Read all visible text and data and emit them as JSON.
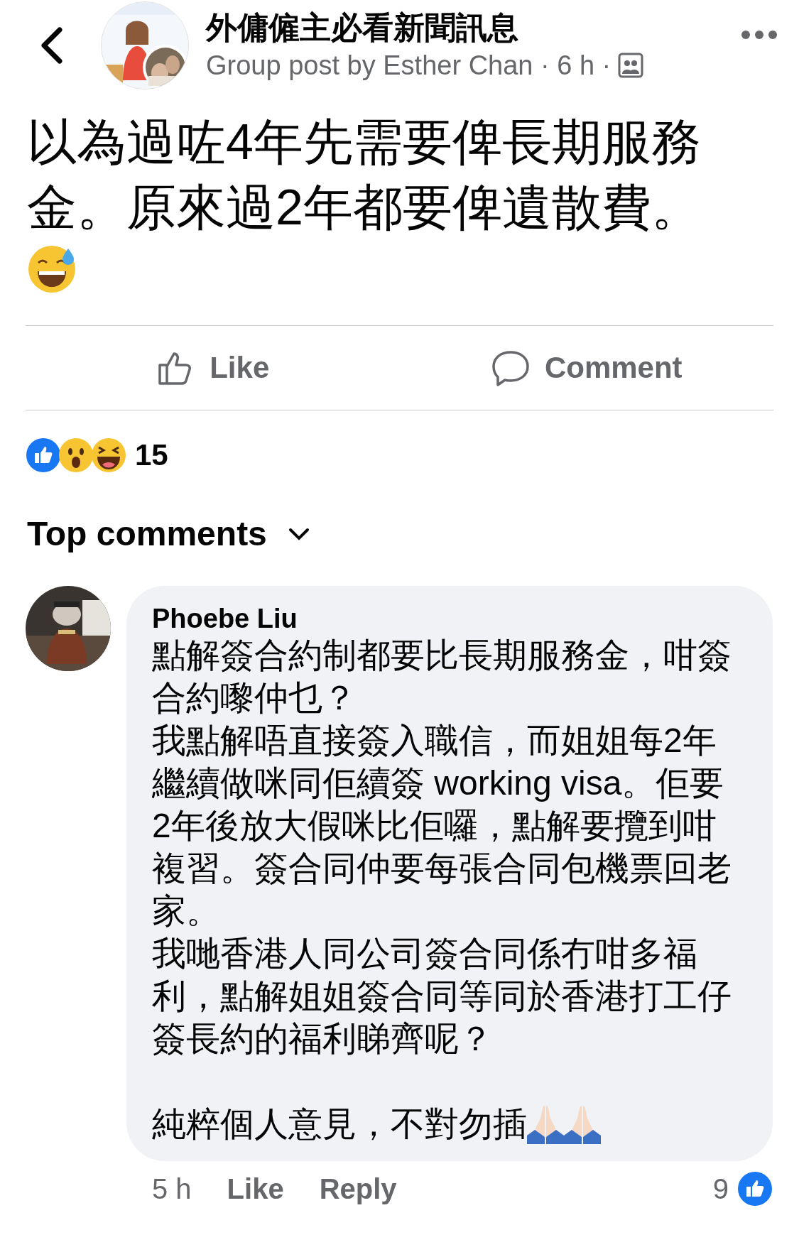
{
  "header": {
    "group_name": "外傭僱主必看新聞訊息",
    "subtitle": "Group post by Esther Chan · 6 h ·"
  },
  "post": {
    "text": "以為過咗4年先需要俾長期服務金。原來過2年都要俾遺散費。",
    "actions": [
      {
        "label": "Like",
        "kind": "like"
      },
      {
        "label": "Comment",
        "kind": "comment"
      }
    ],
    "reactions": {
      "count": "15"
    }
  },
  "comments_sort": {
    "label": "Top comments"
  },
  "comments": [
    {
      "author": "Phoebe Liu",
      "paragraphs": [
        "點解簽合約制都要比長期服務金，咁簽合約嚟仲乜？",
        "我點解唔直接簽入職信，而姐姐每2年繼續做咪同佢續簽 working visa。佢要2年後放大假咪比佢囉，點解要攬到咁複習。簽合同仲要每張合同包機票回老家。",
        "我哋香港人同公司簽合同係冇咁多福利，點解姐姐簽合同等同於香港打工仔簽長約的福利睇齊呢？",
        "純粹個人意見，不對勿插"
      ],
      "time": "5 h",
      "actions": [
        "Like",
        "Reply"
      ],
      "like_count": "9"
    }
  ]
}
